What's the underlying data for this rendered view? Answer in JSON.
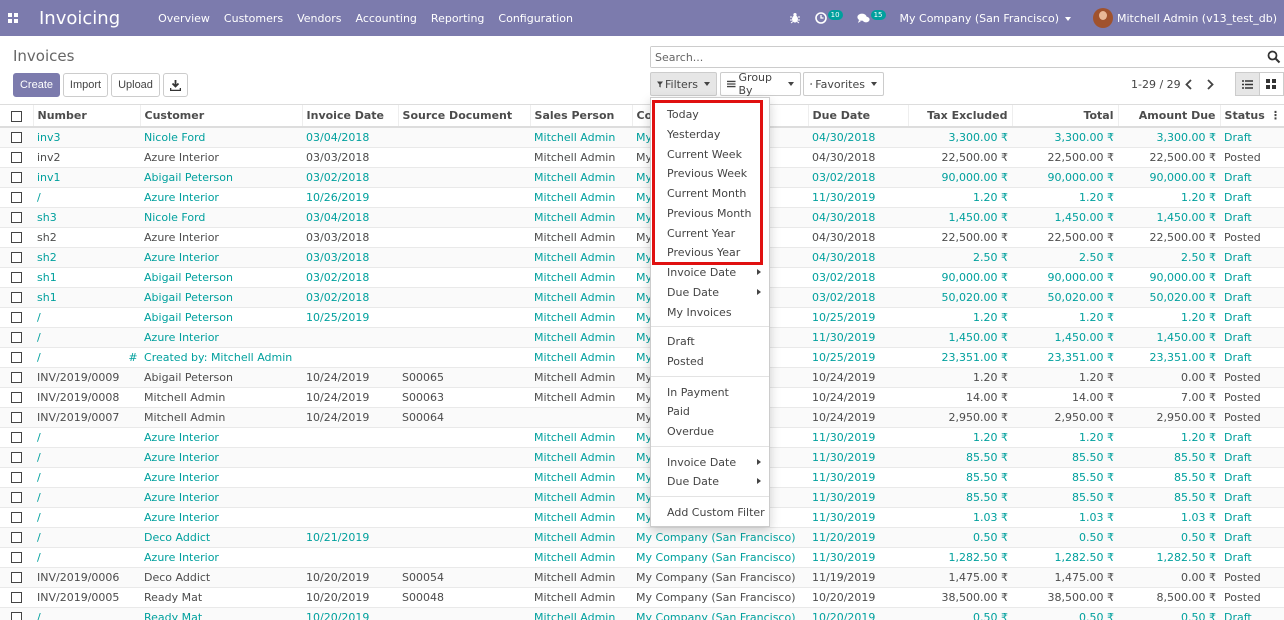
{
  "navbar": {
    "brand": "Invoicing",
    "menu": [
      "Overview",
      "Customers",
      "Vendors",
      "Accounting",
      "Reporting",
      "Configuration"
    ],
    "activity_badge": "10",
    "messages_badge": "15",
    "company": "My Company (San Francisco)",
    "user": "Mitchell Admin (v13_test_db)"
  },
  "page": {
    "title": "Invoices",
    "create_label": "Create",
    "import_label": "Import",
    "upload_label": "Upload",
    "search_placeholder": "Search...",
    "filters_label": "Filters",
    "groupby_label": "Group By",
    "favorites_label": "Favorites",
    "pager": "1-29 / 29"
  },
  "table": {
    "columns": [
      "Number",
      "Customer",
      "Invoice Date",
      "Source Document",
      "Sales Person",
      "Co",
      "Due Date",
      "Tax Excluded",
      "Total",
      "Amount Due",
      "Status"
    ],
    "rows": [
      {
        "number": "inv3",
        "mark": "",
        "customer": "Nicole Ford",
        "invoice_date": "03/04/2018",
        "source": "",
        "sales_person": "Mitchell Admin",
        "company": "My",
        "due_date": "04/30/2018",
        "tax_excluded": "3,300.00 ₹",
        "total": "3,300.00 ₹",
        "amount_due": "3,300.00 ₹",
        "status": "Draft"
      },
      {
        "number": "inv2",
        "mark": "",
        "customer": "Azure Interior",
        "invoice_date": "03/03/2018",
        "source": "",
        "sales_person": "Mitchell Admin",
        "company": "My",
        "due_date": "04/30/2018",
        "tax_excluded": "22,500.00 ₹",
        "total": "22,500.00 ₹",
        "amount_due": "22,500.00 ₹",
        "status": "Posted"
      },
      {
        "number": "inv1",
        "mark": "",
        "customer": "Abigail Peterson",
        "invoice_date": "03/02/2018",
        "source": "",
        "sales_person": "Mitchell Admin",
        "company": "My",
        "due_date": "03/02/2018",
        "tax_excluded": "90,000.00 ₹",
        "total": "90,000.00 ₹",
        "amount_due": "90,000.00 ₹",
        "status": "Draft"
      },
      {
        "number": "/",
        "mark": "",
        "customer": "Azure Interior",
        "invoice_date": "10/26/2019",
        "source": "",
        "sales_person": "Mitchell Admin",
        "company": "My",
        "due_date": "11/30/2019",
        "tax_excluded": "1.20 ₹",
        "total": "1.20 ₹",
        "amount_due": "1.20 ₹",
        "status": "Draft"
      },
      {
        "number": "sh3",
        "mark": "",
        "customer": "Nicole Ford",
        "invoice_date": "03/04/2018",
        "source": "",
        "sales_person": "Mitchell Admin",
        "company": "My",
        "due_date": "04/30/2018",
        "tax_excluded": "1,450.00 ₹",
        "total": "1,450.00 ₹",
        "amount_due": "1,450.00 ₹",
        "status": "Draft"
      },
      {
        "number": "sh2",
        "mark": "",
        "customer": "Azure Interior",
        "invoice_date": "03/03/2018",
        "source": "",
        "sales_person": "Mitchell Admin",
        "company": "My",
        "due_date": "04/30/2018",
        "tax_excluded": "22,500.00 ₹",
        "total": "22,500.00 ₹",
        "amount_due": "22,500.00 ₹",
        "status": "Posted"
      },
      {
        "number": "sh2",
        "mark": "",
        "customer": "Azure Interior",
        "invoice_date": "03/03/2018",
        "source": "",
        "sales_person": "Mitchell Admin",
        "company": "My",
        "due_date": "04/30/2018",
        "tax_excluded": "2.50 ₹",
        "total": "2.50 ₹",
        "amount_due": "2.50 ₹",
        "status": "Draft"
      },
      {
        "number": "sh1",
        "mark": "",
        "customer": "Abigail Peterson",
        "invoice_date": "03/02/2018",
        "source": "",
        "sales_person": "Mitchell Admin",
        "company": "My",
        "due_date": "03/02/2018",
        "tax_excluded": "90,000.00 ₹",
        "total": "90,000.00 ₹",
        "amount_due": "90,000.00 ₹",
        "status": "Draft"
      },
      {
        "number": "sh1",
        "mark": "",
        "customer": "Abigail Peterson",
        "invoice_date": "03/02/2018",
        "source": "",
        "sales_person": "Mitchell Admin",
        "company": "My",
        "due_date": "03/02/2018",
        "tax_excluded": "50,020.00 ₹",
        "total": "50,020.00 ₹",
        "amount_due": "50,020.00 ₹",
        "status": "Draft"
      },
      {
        "number": "/",
        "mark": "",
        "customer": "Abigail Peterson",
        "invoice_date": "10/25/2019",
        "source": "",
        "sales_person": "Mitchell Admin",
        "company": "My",
        "due_date": "10/25/2019",
        "tax_excluded": "1.20 ₹",
        "total": "1.20 ₹",
        "amount_due": "1.20 ₹",
        "status": "Draft"
      },
      {
        "number": "/",
        "mark": "",
        "customer": "Azure Interior",
        "invoice_date": "",
        "source": "",
        "sales_person": "Mitchell Admin",
        "company": "My",
        "due_date": "11/30/2019",
        "tax_excluded": "1,450.00 ₹",
        "total": "1,450.00 ₹",
        "amount_due": "1,450.00 ₹",
        "status": "Draft"
      },
      {
        "number": "/",
        "mark": "#",
        "customer": "Created by: Mitchell Admin",
        "invoice_date": "",
        "source": "",
        "sales_person": "Mitchell Admin",
        "company": "My",
        "due_date": "10/25/2019",
        "tax_excluded": "23,351.00 ₹",
        "total": "23,351.00 ₹",
        "amount_due": "23,351.00 ₹",
        "status": "Draft"
      },
      {
        "number": "INV/2019/0009",
        "mark": "",
        "customer": "Abigail Peterson",
        "invoice_date": "10/24/2019",
        "source": "S00065",
        "sales_person": "Mitchell Admin",
        "company": "My",
        "due_date": "10/24/2019",
        "tax_excluded": "1.20 ₹",
        "total": "1.20 ₹",
        "amount_due": "0.00 ₹",
        "status": "Posted"
      },
      {
        "number": "INV/2019/0008",
        "mark": "",
        "customer": "Mitchell Admin",
        "invoice_date": "10/24/2019",
        "source": "S00063",
        "sales_person": "Mitchell Admin",
        "company": "My",
        "due_date": "10/24/2019",
        "tax_excluded": "14.00 ₹",
        "total": "14.00 ₹",
        "amount_due": "7.00 ₹",
        "status": "Posted"
      },
      {
        "number": "INV/2019/0007",
        "mark": "",
        "customer": "Mitchell Admin",
        "invoice_date": "10/24/2019",
        "source": "S00064",
        "sales_person": "",
        "company": "My",
        "due_date": "10/24/2019",
        "tax_excluded": "2,950.00 ₹",
        "total": "2,950.00 ₹",
        "amount_due": "2,950.00 ₹",
        "status": "Posted"
      },
      {
        "number": "/",
        "mark": "",
        "customer": "Azure Interior",
        "invoice_date": "",
        "source": "",
        "sales_person": "Mitchell Admin",
        "company": "My",
        "due_date": "11/30/2019",
        "tax_excluded": "1.20 ₹",
        "total": "1.20 ₹",
        "amount_due": "1.20 ₹",
        "status": "Draft"
      },
      {
        "number": "/",
        "mark": "",
        "customer": "Azure Interior",
        "invoice_date": "",
        "source": "",
        "sales_person": "Mitchell Admin",
        "company": "My",
        "due_date": "11/30/2019",
        "tax_excluded": "85.50 ₹",
        "total": "85.50 ₹",
        "amount_due": "85.50 ₹",
        "status": "Draft"
      },
      {
        "number": "/",
        "mark": "",
        "customer": "Azure Interior",
        "invoice_date": "",
        "source": "",
        "sales_person": "Mitchell Admin",
        "company": "My",
        "due_date": "11/30/2019",
        "tax_excluded": "85.50 ₹",
        "total": "85.50 ₹",
        "amount_due": "85.50 ₹",
        "status": "Draft"
      },
      {
        "number": "/",
        "mark": "",
        "customer": "Azure Interior",
        "invoice_date": "",
        "source": "",
        "sales_person": "Mitchell Admin",
        "company": "My",
        "due_date": "11/30/2019",
        "tax_excluded": "85.50 ₹",
        "total": "85.50 ₹",
        "amount_due": "85.50 ₹",
        "status": "Draft"
      },
      {
        "number": "/",
        "mark": "",
        "customer": "Azure Interior",
        "invoice_date": "",
        "source": "",
        "sales_person": "Mitchell Admin",
        "company": "My",
        "due_date": "11/30/2019",
        "tax_excluded": "1.03 ₹",
        "total": "1.03 ₹",
        "amount_due": "1.03 ₹",
        "status": "Draft"
      },
      {
        "number": "/",
        "mark": "",
        "customer": "Deco Addict",
        "invoice_date": "10/21/2019",
        "source": "",
        "sales_person": "Mitchell Admin",
        "company": "My Company (San Francisco)",
        "due_date": "11/20/2019",
        "tax_excluded": "0.50 ₹",
        "total": "0.50 ₹",
        "amount_due": "0.50 ₹",
        "status": "Draft"
      },
      {
        "number": "/",
        "mark": "",
        "customer": "Azure Interior",
        "invoice_date": "",
        "source": "",
        "sales_person": "Mitchell Admin",
        "company": "My Company (San Francisco)",
        "due_date": "11/30/2019",
        "tax_excluded": "1,282.50 ₹",
        "total": "1,282.50 ₹",
        "amount_due": "1,282.50 ₹",
        "status": "Draft"
      },
      {
        "number": "INV/2019/0006",
        "mark": "",
        "customer": "Deco Addict",
        "invoice_date": "10/20/2019",
        "source": "S00054",
        "sales_person": "Mitchell Admin",
        "company": "My Company (San Francisco)",
        "due_date": "11/19/2019",
        "tax_excluded": "1,475.00 ₹",
        "total": "1,475.00 ₹",
        "amount_due": "0.00 ₹",
        "status": "Posted"
      },
      {
        "number": "INV/2019/0005",
        "mark": "",
        "customer": "Ready Mat",
        "invoice_date": "10/20/2019",
        "source": "S00048",
        "sales_person": "Mitchell Admin",
        "company": "My Company (San Francisco)",
        "due_date": "10/20/2019",
        "tax_excluded": "38,500.00 ₹",
        "total": "38,500.00 ₹",
        "amount_due": "8,500.00 ₹",
        "status": "Posted"
      },
      {
        "number": "/",
        "mark": "",
        "customer": "Ready Mat",
        "invoice_date": "10/20/2019",
        "source": "",
        "sales_person": "Mitchell Admin",
        "company": "My Company (San Francisco)",
        "due_date": "10/20/2019",
        "tax_excluded": "0.50 ₹",
        "total": "0.50 ₹",
        "amount_due": "0.50 ₹",
        "status": "Draft"
      }
    ]
  },
  "filters_menu": {
    "date_group": [
      "Today",
      "Yesterday",
      "Current Week",
      "Previous Week",
      "Current Month",
      "Previous Month",
      "Current Year",
      "Previous Year"
    ],
    "invoice_date": "Invoice Date",
    "due_date": "Due Date",
    "my_invoices": "My Invoices",
    "draft": "Draft",
    "posted": "Posted",
    "in_payment": "In Payment",
    "paid": "Paid",
    "overdue": "Overdue",
    "invoice_date_2": "Invoice Date",
    "due_date_2": "Due Date",
    "add_custom": "Add Custom Filter"
  },
  "colors": {
    "navbar": "#7c7bad",
    "link": "#00a09d",
    "highlight": "#e01010"
  }
}
